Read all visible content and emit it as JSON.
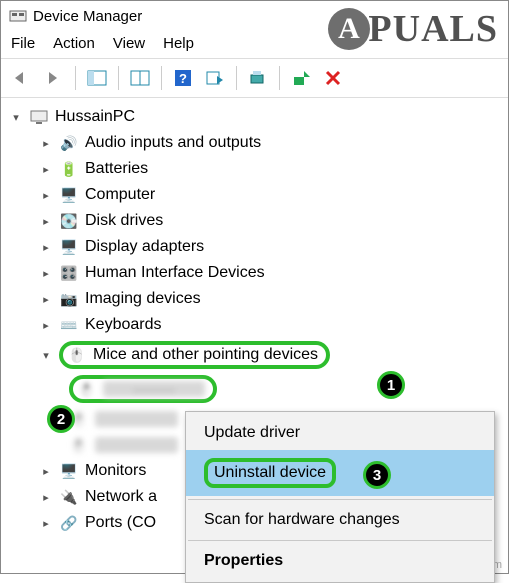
{
  "watermark": "PUALS",
  "source_mark": "wsxdn.com",
  "window": {
    "title": "Device Manager"
  },
  "menu": {
    "file": "File",
    "action": "Action",
    "view": "View",
    "help": "Help"
  },
  "tree": {
    "root": "HussainPC",
    "items": [
      "Audio inputs and outputs",
      "Batteries",
      "Computer",
      "Disk drives",
      "Display adapters",
      "Human Interface Devices",
      "Imaging devices",
      "Keyboards",
      "Mice and other pointing devices"
    ],
    "tail": [
      "Monitors",
      "Network a",
      "Ports (CO"
    ],
    "blurred_child": "———"
  },
  "context": {
    "update": "Update driver",
    "uninstall": "Uninstall device",
    "scan": "Scan for hardware changes",
    "props": "Properties"
  },
  "badges": {
    "b1": "1",
    "b2": "2",
    "b3": "3"
  }
}
